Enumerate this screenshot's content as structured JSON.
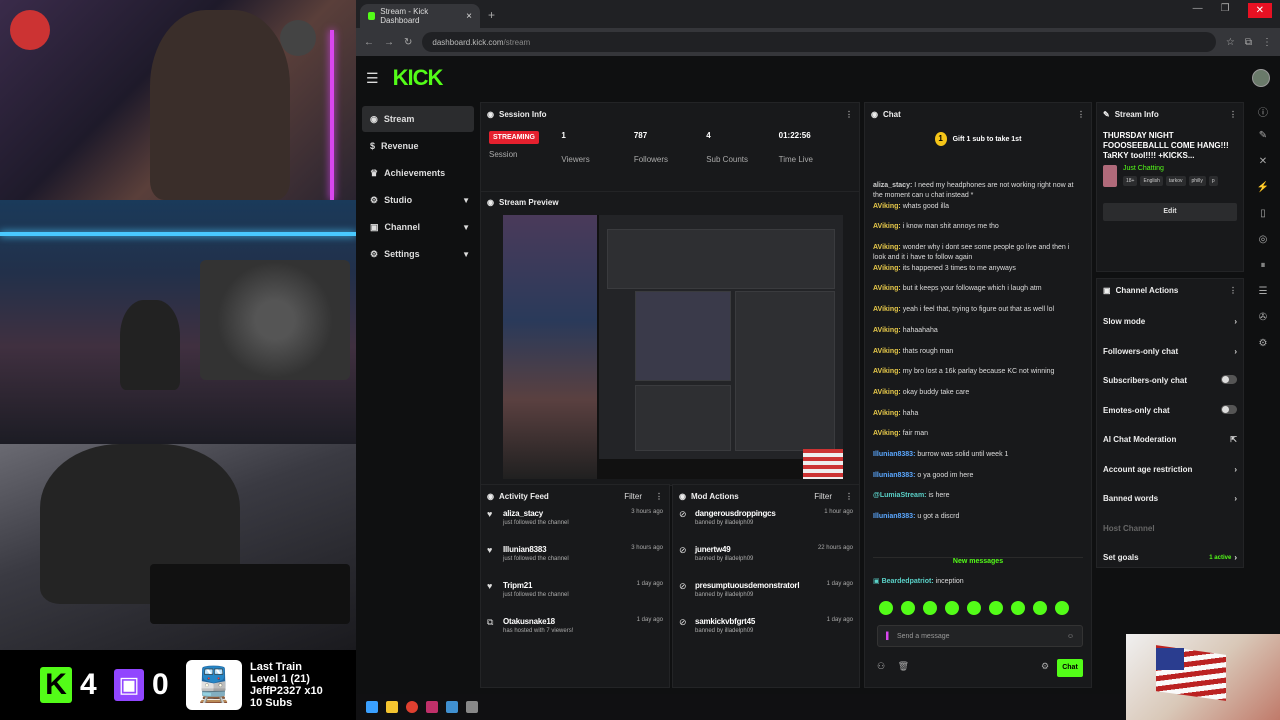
{
  "browser": {
    "tab_title": "Stream - Kick Dashboard",
    "url_host": "dashboard.kick.com",
    "url_path": "/stream"
  },
  "logo": "KICK",
  "sidebar": {
    "items": [
      {
        "label": "Stream",
        "icon": "radio-icon"
      },
      {
        "label": "Revenue",
        "icon": "dollar-icon"
      },
      {
        "label": "Achievements",
        "icon": "trophy-icon"
      },
      {
        "label": "Studio",
        "icon": "gear-icon"
      },
      {
        "label": "Channel",
        "icon": "channel-icon"
      },
      {
        "label": "Settings",
        "icon": "gear-icon"
      }
    ]
  },
  "session": {
    "title": "Session Info",
    "status": "STREAMING",
    "status_label": "Session",
    "stats": [
      {
        "value": "1",
        "label": "Viewers"
      },
      {
        "value": "787",
        "label": "Followers"
      },
      {
        "value": "4",
        "label": "Sub Counts"
      },
      {
        "value": "01:22:56",
        "label": "Time Live"
      }
    ],
    "preview_title": "Stream Preview"
  },
  "activity": {
    "title": "Activity Feed",
    "filter": "Filter",
    "items": [
      {
        "name": "aliza_stacy",
        "sub": "just followed the channel",
        "time": "3 hours ago"
      },
      {
        "name": "Illunian8383",
        "sub": "just followed the channel",
        "time": "3 hours ago"
      },
      {
        "name": "Tripm21",
        "sub": "just followed the channel",
        "time": "1 day ago"
      },
      {
        "name": "Otakusnake18",
        "sub": "has hosted with 7 viewers!",
        "time": "1 day ago"
      }
    ]
  },
  "mod": {
    "title": "Mod Actions",
    "filter": "Filter",
    "items": [
      {
        "name": "dangerousdroppingcs",
        "sub": "banned by illadelph09",
        "time": "1 hour ago"
      },
      {
        "name": "junertw49",
        "sub": "banned by illadelph09",
        "time": "22 hours ago"
      },
      {
        "name": "presumptuousdemonstratorl",
        "sub": "banned by illadelph09",
        "time": "1 day ago"
      },
      {
        "name": "samkickvbfgrt45",
        "sub": "banned by illadelph09",
        "time": "1 day ago"
      }
    ]
  },
  "chat": {
    "title": "Chat",
    "gift": "Gift 1 sub to take 1st",
    "messages": [
      {
        "user": "aliza_stacy:",
        "text": "I need my headphones are not working right now at the moment can u chat instead *",
        "color": "#cfcfcf"
      },
      {
        "user": "AViking:",
        "text": "whats good illa",
        "color": "#e6c84a"
      },
      {
        "user": "AViking:",
        "text": "i know man shit annoys me tho",
        "color": "#e6c84a"
      },
      {
        "user": "AViking:",
        "text": "wonder why i dont see some people go live and then i look and it i have to follow again",
        "color": "#e6c84a"
      },
      {
        "user": "AViking:",
        "text": "its happened 3 times to me anyways",
        "color": "#e6c84a"
      },
      {
        "user": "AViking:",
        "text": "but it keeps your followage which i laugh atm",
        "color": "#e6c84a"
      },
      {
        "user": "AViking:",
        "text": "yeah i feel that, trying to figure out that as well lol",
        "color": "#e6c84a"
      },
      {
        "user": "AViking:",
        "text": "hahaahaha",
        "color": "#e6c84a"
      },
      {
        "user": "AViking:",
        "text": "thats rough man",
        "color": "#e6c84a"
      },
      {
        "user": "AViking:",
        "text": "my bro lost a 16k parlay because KC not winning",
        "color": "#e6c84a"
      },
      {
        "user": "AViking:",
        "text": "okay buddy take care",
        "color": "#e6c84a"
      },
      {
        "user": "AViking:",
        "text": "haha",
        "color": "#e6c84a"
      },
      {
        "user": "AViking:",
        "text": "fair man",
        "color": "#e6c84a"
      },
      {
        "user": "Illunian8383:",
        "text": "burrow was solid until week 1",
        "color": "#5aa7ff"
      },
      {
        "user": "Illunian8383:",
        "text": "o ya good im here",
        "color": "#5aa7ff"
      },
      {
        "user": "@LumiaStream:",
        "text": "is here",
        "color": "#5ad1c8"
      },
      {
        "user": "Illunian8383:",
        "text": "u got a discrd",
        "color": "#5aa7ff"
      }
    ],
    "new_messages": "New messages",
    "last_message_user": "Beardedpatriot:",
    "last_message_text": "inception",
    "input_placeholder": "Send a message",
    "send_label": "Chat"
  },
  "stream_info": {
    "title": "Stream Info",
    "stream_title": "THURSDAY NIGHT FOOOSEEBALLL COME HANG!!! TaRKY tool!!!! +KICKS...",
    "category": "Just Chatting",
    "tags": [
      "18+",
      "English",
      "tarkov",
      "philly",
      "p"
    ],
    "edit_label": "Edit"
  },
  "channel_actions": {
    "title": "Channel Actions",
    "items": [
      {
        "label": "Slow mode",
        "control": "chevron"
      },
      {
        "label": "Followers-only chat",
        "control": "chevron"
      },
      {
        "label": "Subscribers-only chat",
        "control": "toggle"
      },
      {
        "label": "Emotes-only chat",
        "control": "toggle"
      },
      {
        "label": "AI Chat Moderation",
        "control": "external"
      },
      {
        "label": "Account age restriction",
        "control": "chevron"
      },
      {
        "label": "Banned words",
        "control": "chevron"
      },
      {
        "label": "Host Channel",
        "control": "none"
      },
      {
        "label": "Set goals",
        "control": "chevron",
        "extra": "1 active"
      }
    ]
  },
  "overlay": {
    "kick_count": "4",
    "twitch_count": "0",
    "train_line1": "Last Train",
    "train_line2": "Level 1  (21)",
    "train_line3": "JeffP2327 x10",
    "train_line4": "10 Subs"
  },
  "colors": {
    "accent": "#53fc18",
    "live": "#e5202e",
    "panel": "#18191b"
  }
}
